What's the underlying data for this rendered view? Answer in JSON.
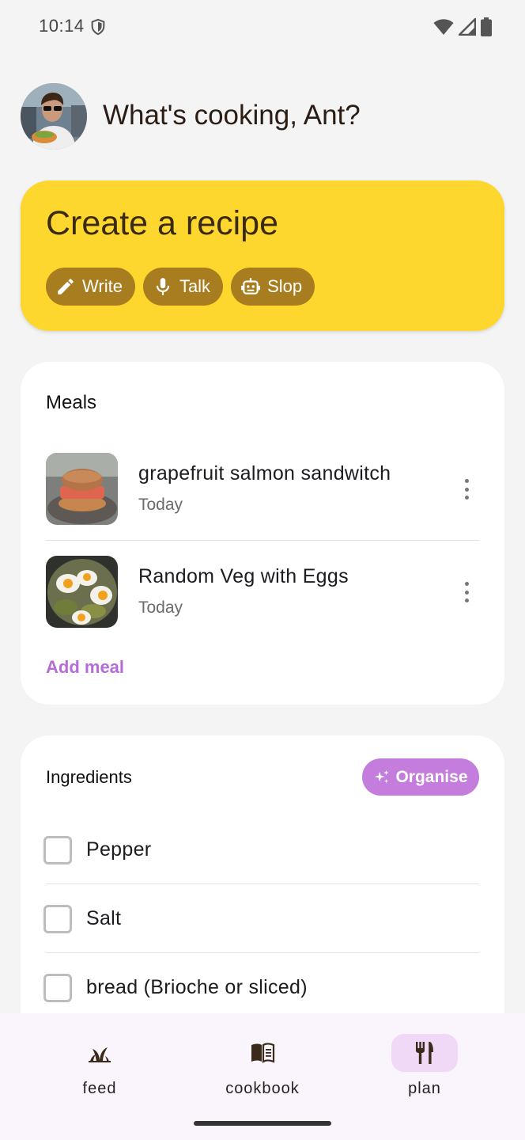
{
  "status_bar": {
    "time": "10:14",
    "icons": [
      "shield-icon",
      "wifi-icon",
      "signal-icon",
      "battery-icon"
    ]
  },
  "header": {
    "greeting": "What's cooking, Ant?",
    "avatar": "avatar-photo"
  },
  "create_card": {
    "title": "Create a recipe",
    "actions": [
      {
        "label": "Write",
        "icon": "pencil-icon"
      },
      {
        "label": "Talk",
        "icon": "microphone-icon"
      },
      {
        "label": "Slop",
        "icon": "robot-icon"
      }
    ],
    "color": "#fdd62e"
  },
  "meals": {
    "heading": "Meals",
    "items": [
      {
        "name": "grapefruit salmon sandwitch",
        "date": "Today"
      },
      {
        "name": "Random Veg with Eggs",
        "date": "Today"
      }
    ],
    "add_label": "Add meal"
  },
  "ingredients": {
    "heading": "Ingredients",
    "organise_label": "Organise",
    "items": [
      {
        "label": "Pepper",
        "checked": false
      },
      {
        "label": "Salt",
        "checked": false
      },
      {
        "label": "bread (Brioche or sliced)",
        "checked": false
      }
    ]
  },
  "bottom_nav": {
    "items": [
      {
        "label": "feed",
        "icon": "sprout-icon",
        "active": false
      },
      {
        "label": "cookbook",
        "icon": "book-icon",
        "active": false
      },
      {
        "label": "plan",
        "icon": "fork-knife-icon",
        "active": true
      }
    ]
  },
  "colors": {
    "accent": "#c47ddd",
    "link": "#b46cd8",
    "chip": "#a87d1f",
    "nav_active": "#f0d9f7"
  }
}
